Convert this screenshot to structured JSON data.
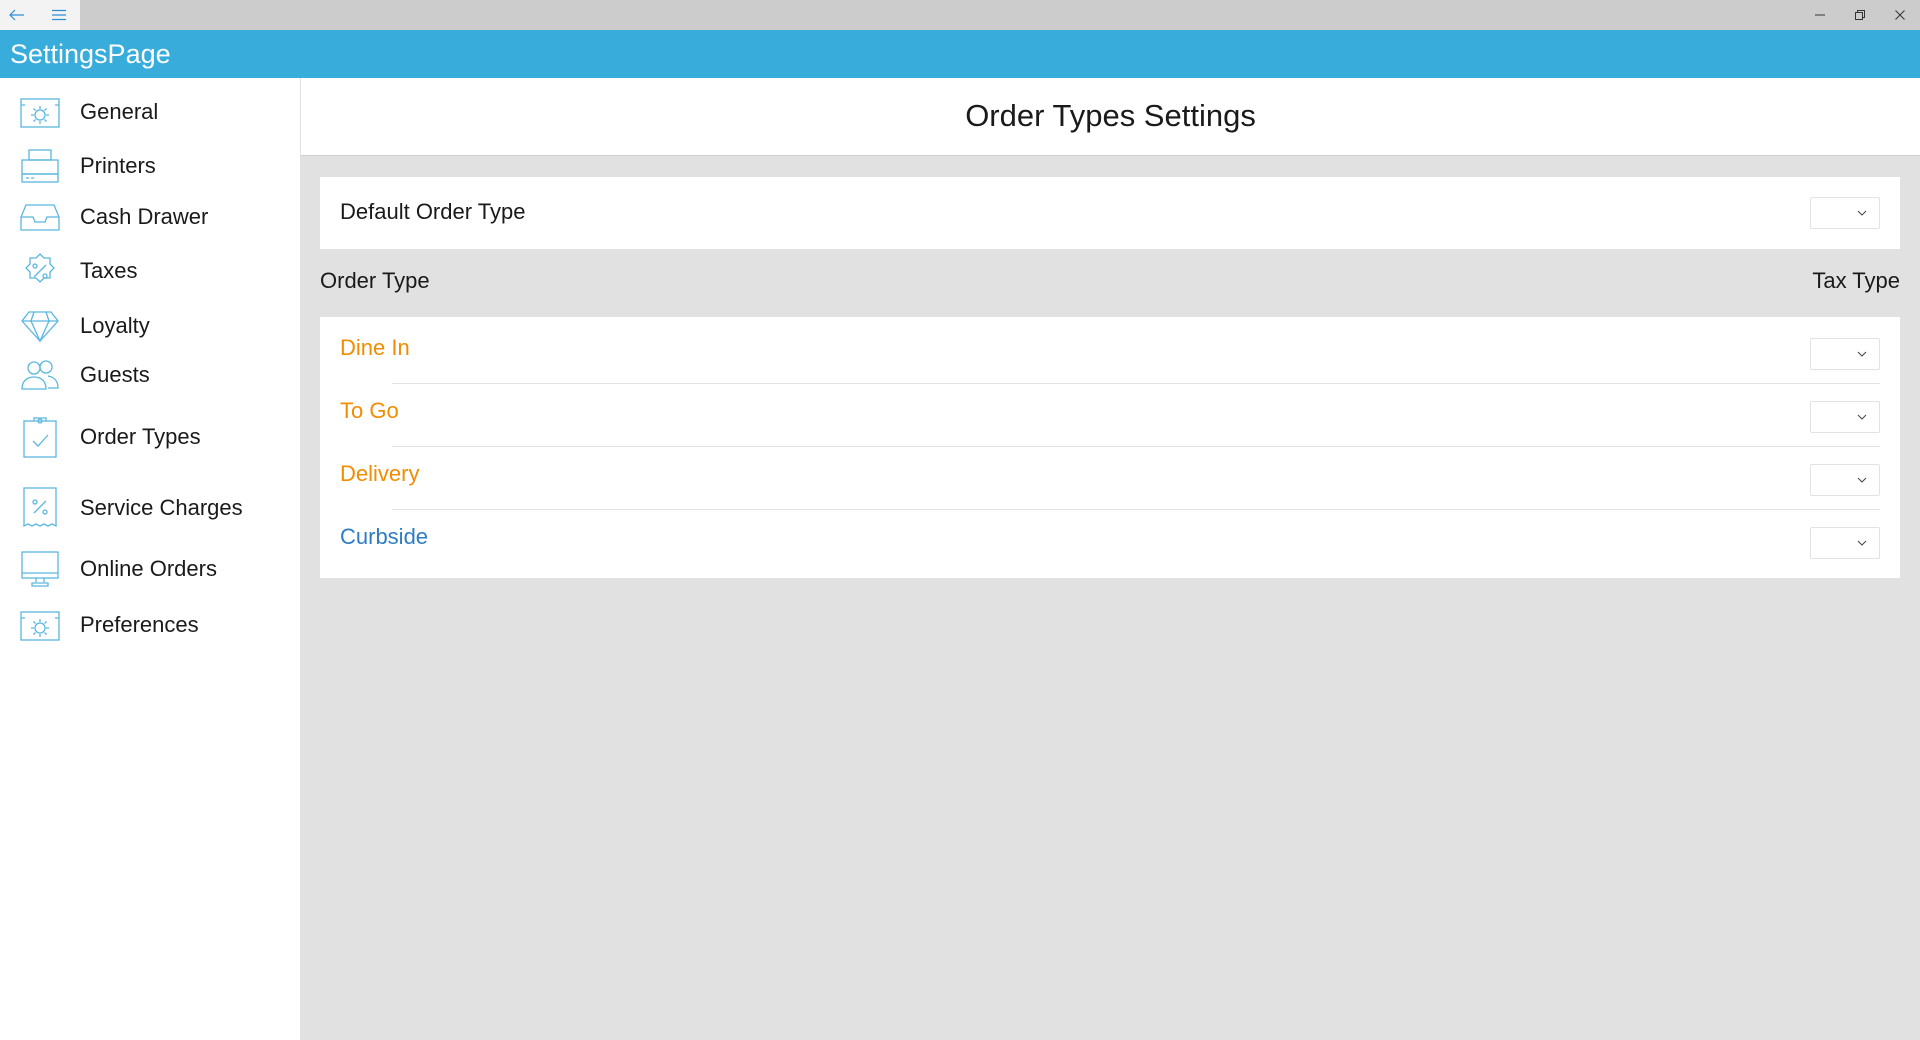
{
  "app": {
    "title": "SettingsPage"
  },
  "titlebar": {
    "back_icon": "arrow-left-icon",
    "menu_icon": "hamburger-icon",
    "minimize_icon": "minimize-icon",
    "restore_icon": "restore-icon",
    "close_icon": "close-icon"
  },
  "sidebar": {
    "items": [
      {
        "label": "General",
        "icon": "gear-panel-icon"
      },
      {
        "label": "Printers",
        "icon": "printer-icon"
      },
      {
        "label": "Cash Drawer",
        "icon": "cash-drawer-icon"
      },
      {
        "label": "Taxes",
        "icon": "percent-badge-icon"
      },
      {
        "label": "Loyalty",
        "icon": "diamond-icon"
      },
      {
        "label": "Guests",
        "icon": "guests-icon"
      },
      {
        "label": "Order Types",
        "icon": "clipboard-check-icon"
      },
      {
        "label": "Service Charges",
        "icon": "percent-receipt-icon"
      },
      {
        "label": "Online Orders",
        "icon": "monitor-icon"
      },
      {
        "label": "Preferences",
        "icon": "gear-panel-icon"
      }
    ]
  },
  "main": {
    "title": "Order Types Settings",
    "default_order_type": {
      "label": "Default Order Type",
      "value": ""
    },
    "columns": {
      "order_type": "Order Type",
      "tax_type": "Tax Type"
    },
    "order_types": [
      {
        "label": "Dine In",
        "tax_type": ""
      },
      {
        "label": "To Go",
        "tax_type": ""
      },
      {
        "label": "Delivery",
        "tax_type": ""
      },
      {
        "label": "Curbside",
        "tax_type": ""
      }
    ]
  },
  "colors": {
    "accent": "#38acdb",
    "titlebar": "#cccccc",
    "content_bg": "#e1e1e1",
    "orange_label": "#f28c00",
    "blue_label": "#2e7cc5",
    "icon_stroke": "#5ab7de"
  }
}
